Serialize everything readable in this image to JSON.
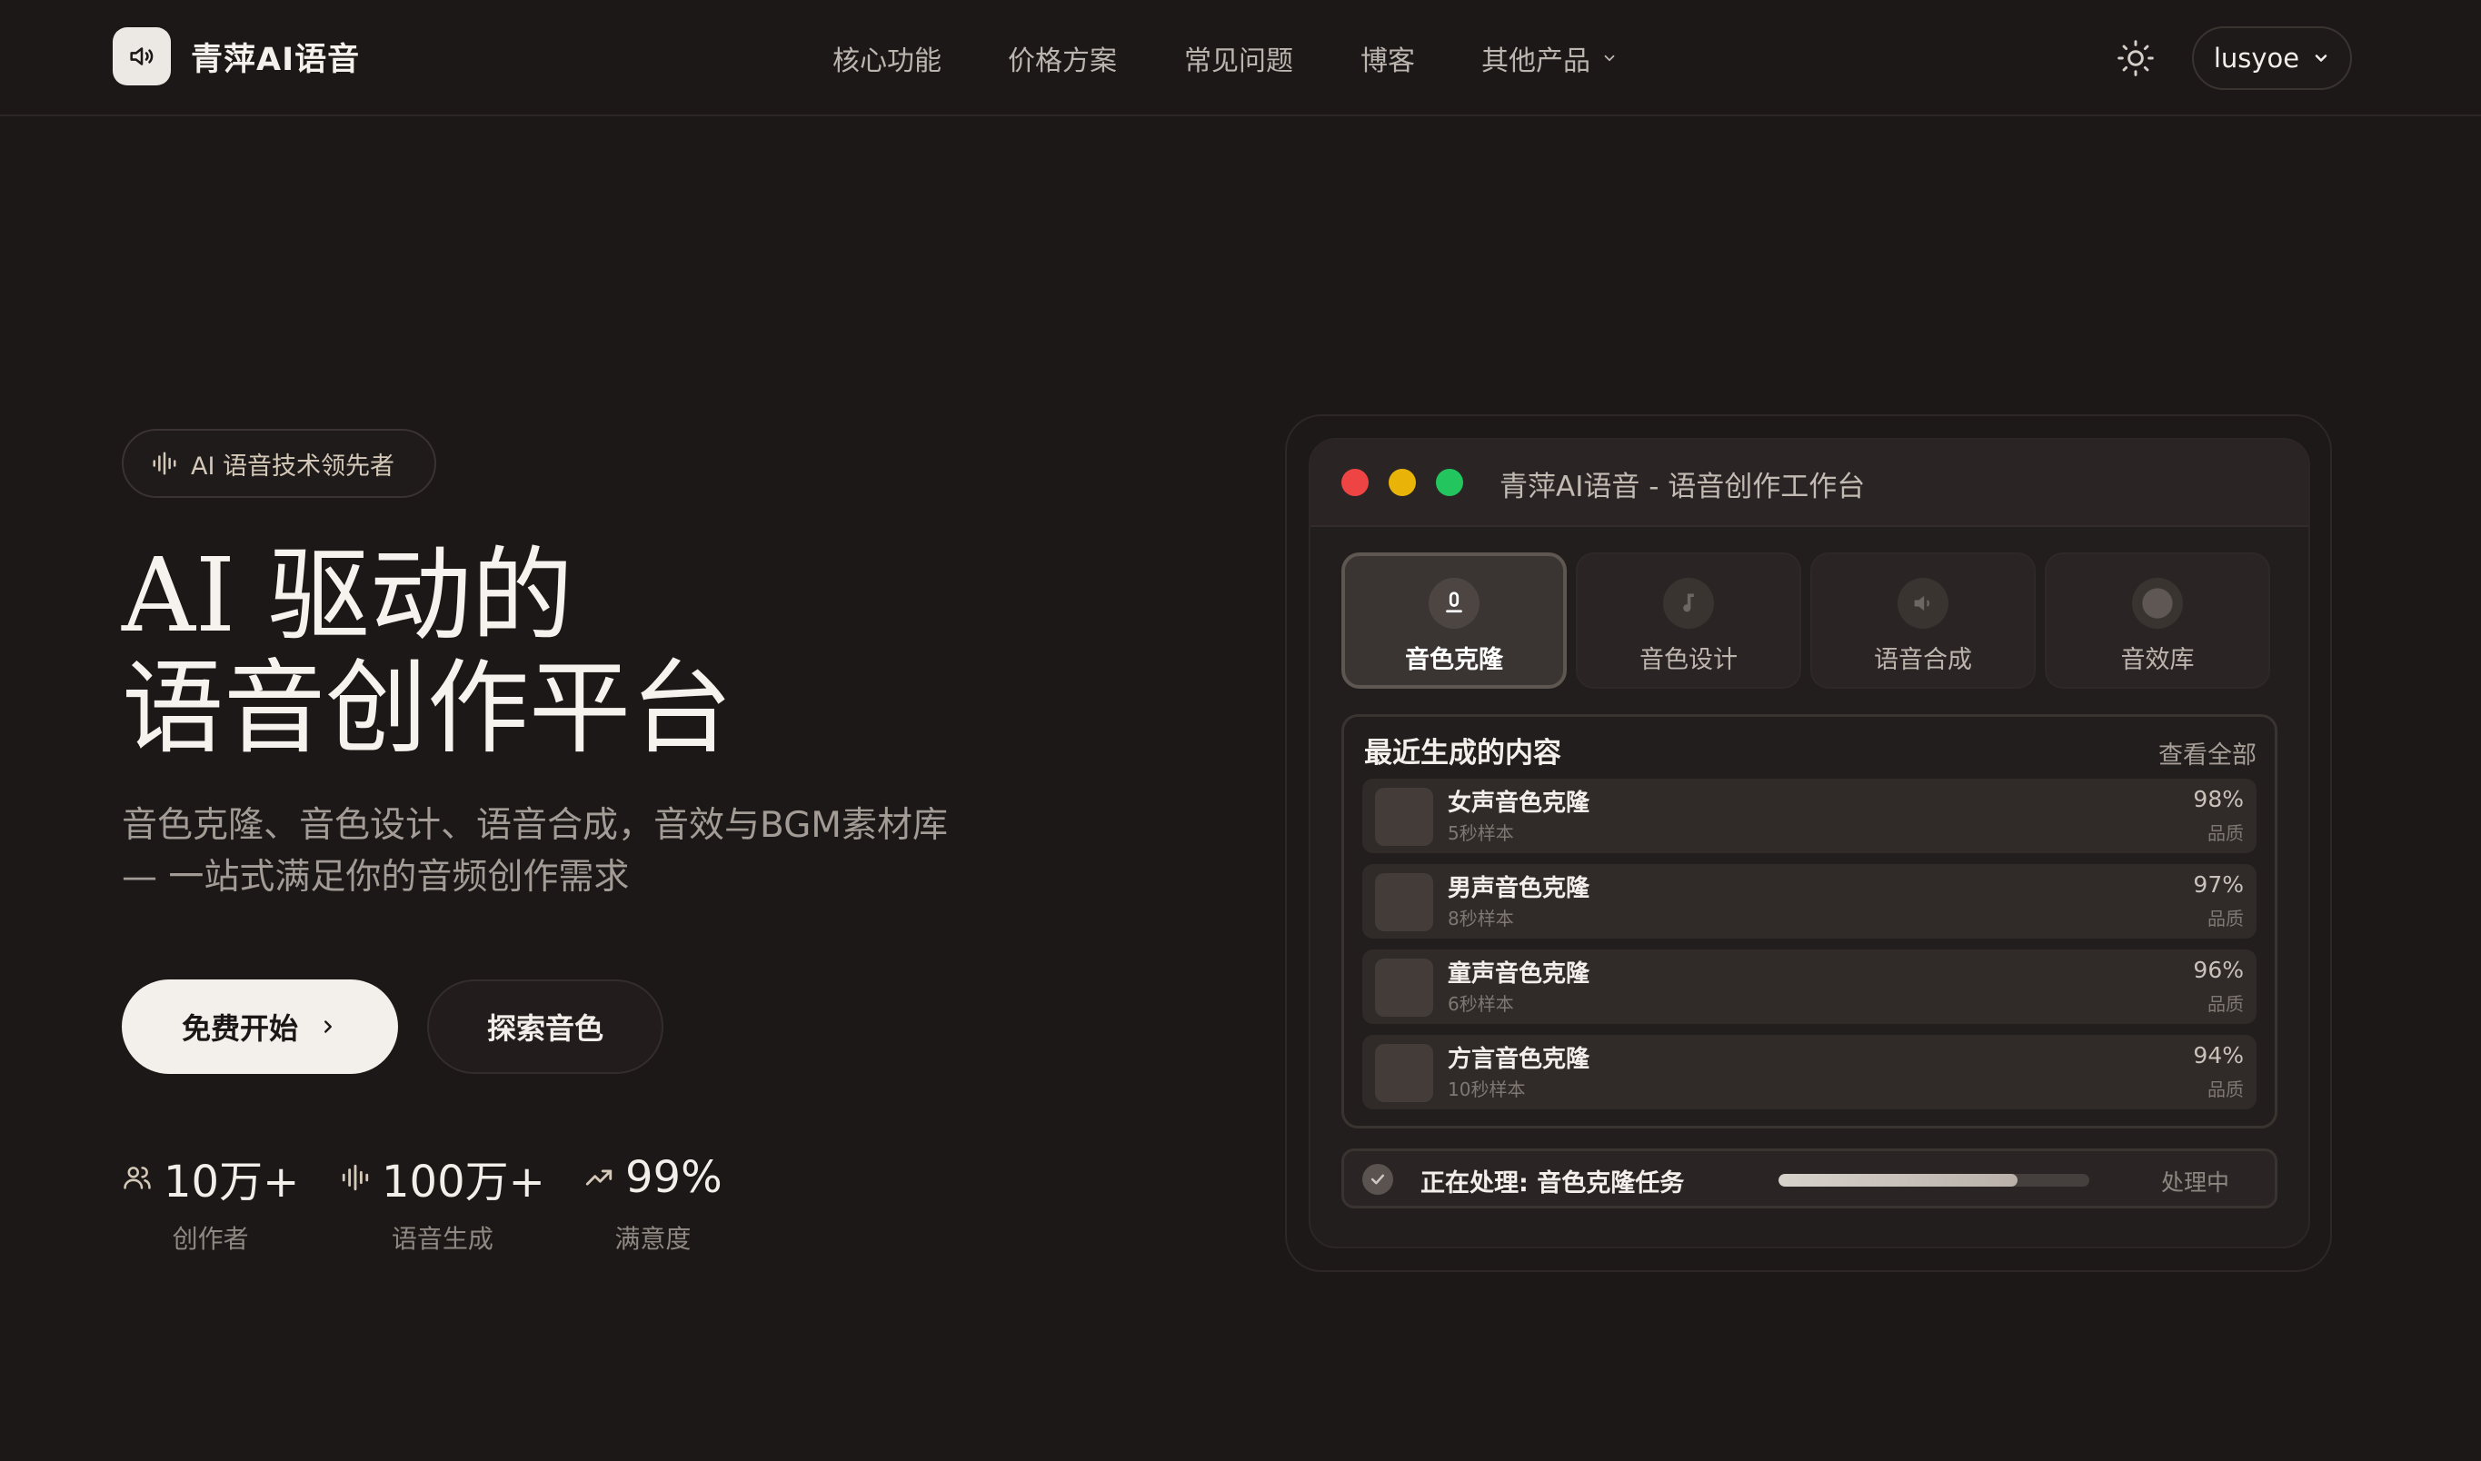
{
  "header": {
    "brand_name": "青萍AI语音",
    "nav": [
      {
        "label": "核心功能"
      },
      {
        "label": "价格方案"
      },
      {
        "label": "常见问题"
      },
      {
        "label": "博客"
      },
      {
        "label": "其他产品",
        "has_dropdown": true
      }
    ],
    "user_name": "lusyoe"
  },
  "hero": {
    "badge": "AI 语音技术领先者",
    "title_line1": "AI 驱动的",
    "title_line2": "语音创作平台",
    "subtitle_line1": "音色克隆、音色设计、语音合成，音效与BGM素材库",
    "subtitle_line2": "— 一站式满足你的音频创作需求",
    "primary_cta": "免费开始",
    "secondary_cta": "探索音色",
    "stats": [
      {
        "icon": "users-icon",
        "value": "10万+",
        "label": "创作者"
      },
      {
        "icon": "waveform-icon",
        "value": "100万+",
        "label": "语音生成"
      },
      {
        "icon": "trend-up-icon",
        "value": "99%",
        "label": "满意度"
      }
    ]
  },
  "workspace": {
    "window_title": "青萍AI语音 - 语音创作工作台",
    "traffic_lights": [
      "#ef4444",
      "#eab308",
      "#22c55e"
    ],
    "tabs": [
      {
        "label": "音色克隆",
        "icon": "microphone-icon",
        "active": true
      },
      {
        "label": "音色设计",
        "icon": "music-note-icon",
        "active": false
      },
      {
        "label": "语音合成",
        "icon": "speaker-icon",
        "active": false
      },
      {
        "label": "音效库",
        "icon": "circle-icon",
        "active": false
      }
    ],
    "recent": {
      "title": "最近生成的内容",
      "view_all": "查看全部",
      "items": [
        {
          "name": "女声音色克隆",
          "meta": "5秒样本",
          "pct": "98%",
          "quality_label": "品质"
        },
        {
          "name": "男声音色克隆",
          "meta": "8秒样本",
          "pct": "97%",
          "quality_label": "品质"
        },
        {
          "name": "童声音色克隆",
          "meta": "6秒样本",
          "pct": "96%",
          "quality_label": "品质"
        },
        {
          "name": "方言音色克隆",
          "meta": "10秒样本",
          "pct": "94%",
          "quality_label": "品质"
        }
      ]
    },
    "processing": {
      "text": "正在处理: 音色克隆任务",
      "status": "处理中",
      "progress": 0.77
    }
  }
}
